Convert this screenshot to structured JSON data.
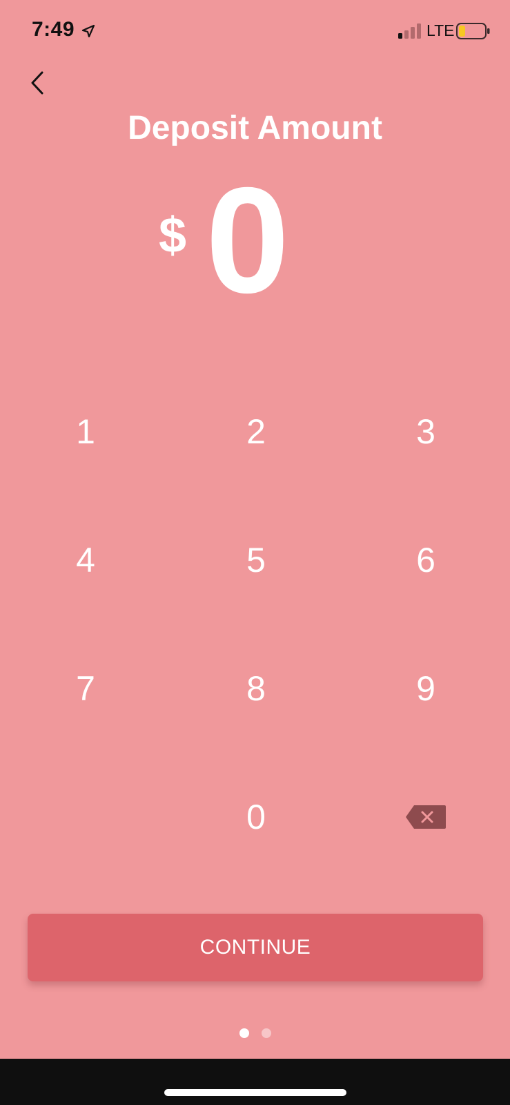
{
  "status_bar": {
    "time": "7:49",
    "network": "LTE",
    "icons": {
      "location": "location-arrow-icon",
      "signal": "cellular-signal-icon",
      "battery": "battery-low-icon"
    }
  },
  "nav": {
    "back_icon": "chevron-left-icon"
  },
  "title": "Deposit Amount",
  "amount": {
    "currency_symbol": "$",
    "value": "0"
  },
  "keypad": {
    "keys": [
      "1",
      "2",
      "3",
      "4",
      "5",
      "6",
      "7",
      "8",
      "9",
      "0"
    ],
    "backspace_icon": "backspace-icon"
  },
  "continue_label": "CONTINUE",
  "pagination": {
    "total": 2,
    "current": 1
  },
  "colors": {
    "background": "#f0989b",
    "button": "#dd646b",
    "backspace": "#8e4b4e",
    "text": "#ffffff"
  }
}
